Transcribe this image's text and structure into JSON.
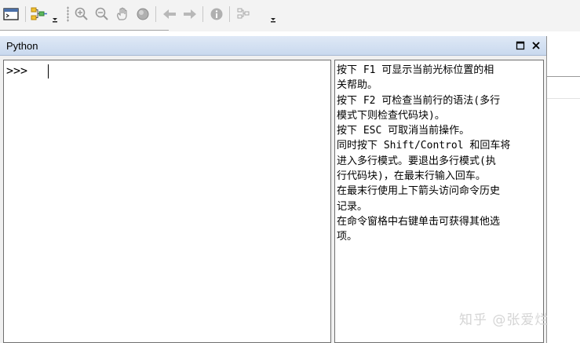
{
  "window": {
    "title": "Python",
    "maximize_glyph": "□",
    "close_glyph": "×"
  },
  "console": {
    "prompt": ">>>"
  },
  "help": {
    "lines": [
      "按下 F1 可显示当前光标位置的相",
      "关帮助。",
      "按下 F2 可检查当前行的语法(多行",
      "模式下则检查代码块)。",
      "按下 ESC 可取消当前操作。",
      "同时按下 Shift/Control 和回车将",
      "进入多行模式。要退出多行模式(执",
      "行代码块)，在最末行输入回车。",
      "在最末行使用上下箭头访问命令历史",
      "记录。",
      "在命令窗格中右键单击可获得其他选",
      "项。"
    ]
  },
  "toolbar": {
    "icons": [
      "window-icon",
      "model-builder-icon",
      "dropdown-icon",
      "zoom-in-icon",
      "zoom-out-icon",
      "pan-icon",
      "full-extent-icon",
      "back-arrow-icon",
      "forward-arrow-icon",
      "identify-icon",
      "layout-icon",
      "dropdown-icon"
    ]
  },
  "watermark": {
    "text": "知乎 @张爱烂"
  },
  "colors": {
    "titlebar": "#d3e0f1",
    "panel_border": "#6f6f6f",
    "arrow_blue": "#4d8fe0"
  }
}
